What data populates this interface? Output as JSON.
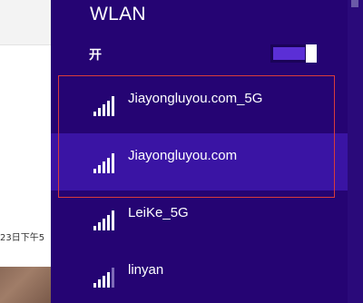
{
  "background": {
    "timestamp_fragment": "23日下午5"
  },
  "panel": {
    "title": "WLAN",
    "toggle_label": "开",
    "toggle_state": "on",
    "networks": [
      {
        "name": "Jiayongluyou.com_5G",
        "signal_bars": 5
      },
      {
        "name": "Jiayongluyou.com",
        "signal_bars": 5,
        "selected": true
      },
      {
        "name": "LeiKe_5G",
        "signal_bars": 5
      },
      {
        "name": "linyan",
        "signal_bars": 4
      }
    ]
  },
  "colors": {
    "panel_bg": "#250473",
    "selected_bg": "#3a14a4",
    "toggle_fill": "#5b2fd6",
    "focus_border": "#d83b3b"
  }
}
